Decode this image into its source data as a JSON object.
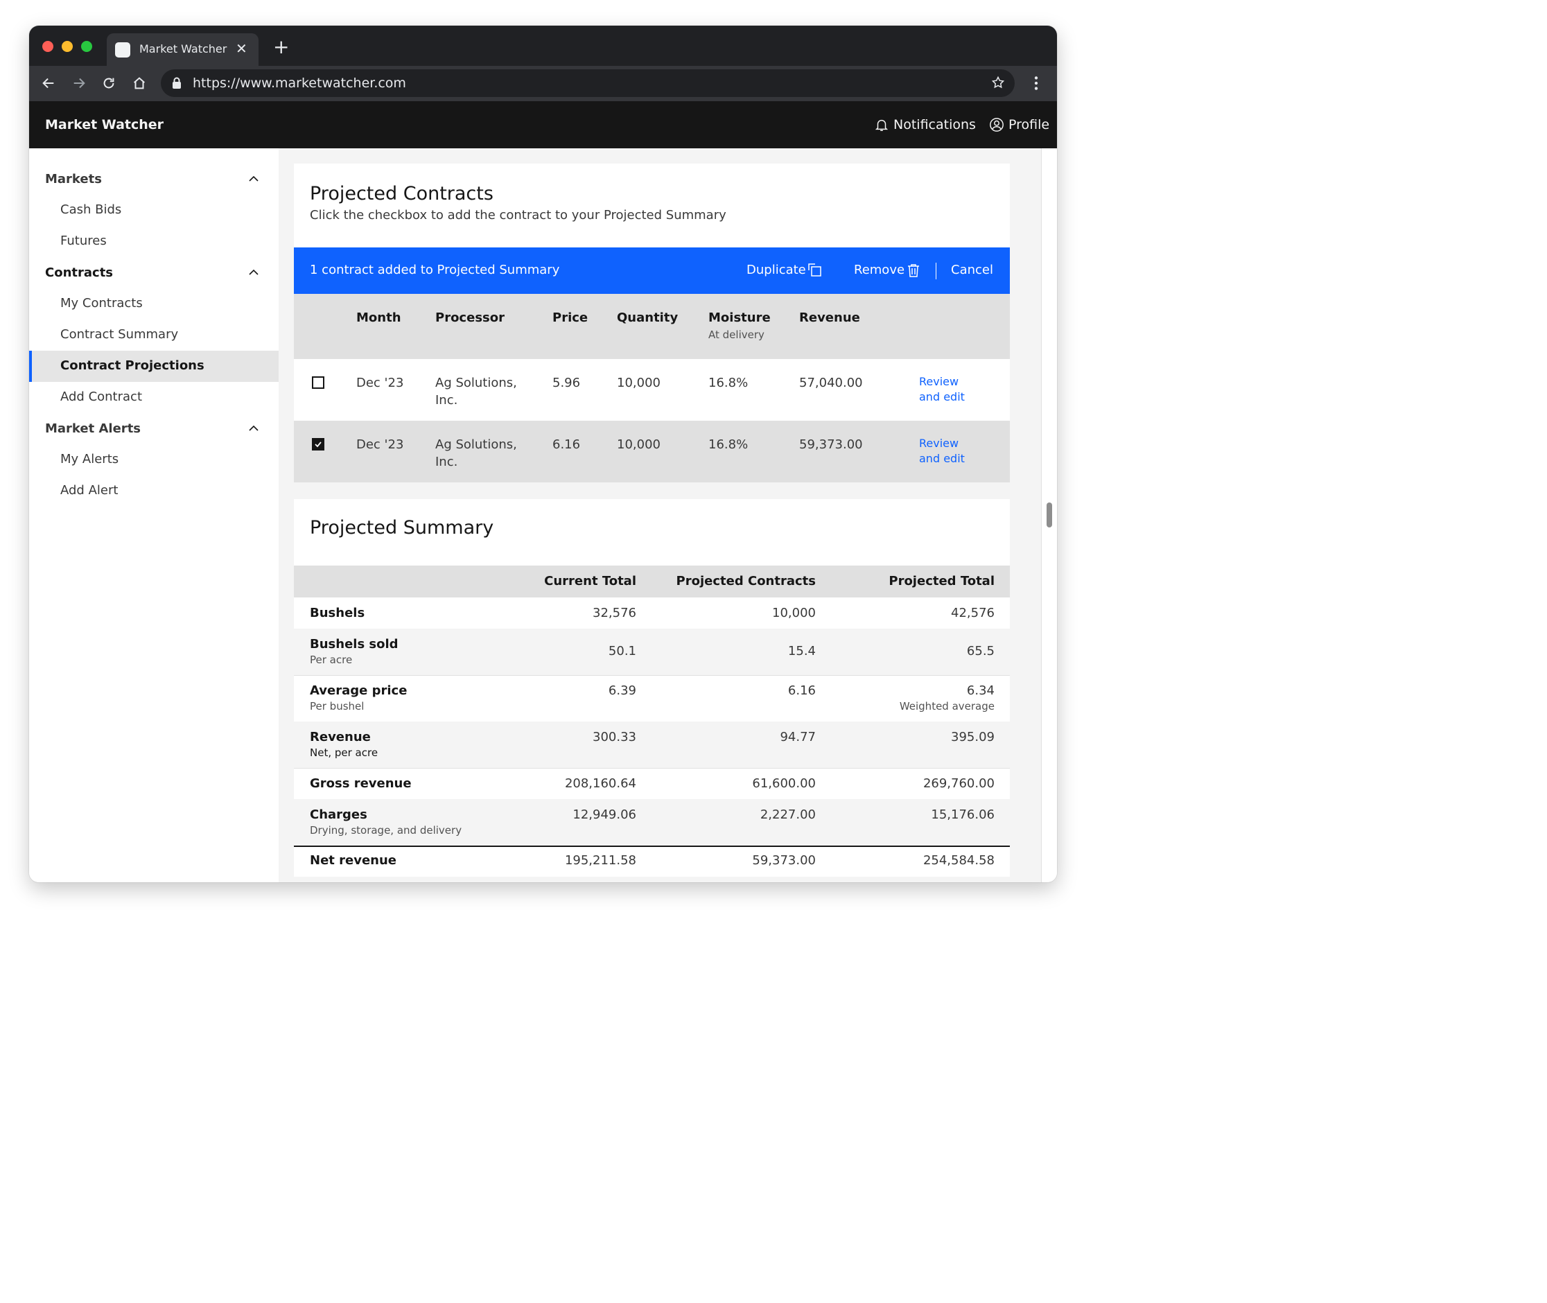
{
  "browser": {
    "tab_title": "Market Watcher",
    "url": "https://www.marketwatcher.com"
  },
  "app": {
    "title": "Market Watcher",
    "notifications_label": "Notifications",
    "profile_label": "Profile"
  },
  "sidebar": {
    "groups": [
      {
        "label": "Markets",
        "items": [
          "Cash Bids",
          "Futures"
        ]
      },
      {
        "label": "Contracts",
        "items": [
          "My Contracts",
          "Contract Summary",
          "Contract Projections",
          "Add Contract"
        ]
      },
      {
        "label": "Market Alerts",
        "items": [
          "My Alerts",
          "Add Alert"
        ]
      }
    ],
    "active_item": "Contract Projections"
  },
  "projected_contracts": {
    "title": "Projected Contracts",
    "subtitle": "Click the checkbox to add the contract to your Projected Summary",
    "action_bar": {
      "message": "1 contract added to Projected Summary",
      "duplicate_label": "Duplicate",
      "remove_label": "Remove",
      "cancel_label": "Cancel"
    },
    "columns": {
      "month": "Month",
      "processor": "Processor",
      "price": "Price",
      "quantity": "Quantity",
      "moisture": "Moisture",
      "moisture_sub": "At delivery",
      "revenue": "Revenue"
    },
    "rows": [
      {
        "checked": false,
        "month": "Dec '23",
        "processor_1": "Ag Solutions,",
        "processor_2": "Inc.",
        "price": "5.96",
        "quantity": "10,000",
        "moisture": "16.8%",
        "revenue": "57,040.00",
        "link_1": "Review",
        "link_2": "and edit"
      },
      {
        "checked": true,
        "month": "Dec '23",
        "processor_1": "Ag Solutions,",
        "processor_2": "Inc.",
        "price": "6.16",
        "quantity": "10,000",
        "moisture": "16.8%",
        "revenue": "59,373.00",
        "link_1": "Review",
        "link_2": "and edit"
      }
    ]
  },
  "projected_summary": {
    "title": "Projected Summary",
    "columns": {
      "current_total": "Current Total",
      "projected_contracts": "Projected Contracts",
      "projected_total": "Projected Total"
    },
    "rows": [
      {
        "label": "Bushels",
        "sub": "",
        "current": "32,576",
        "projected": "10,000",
        "total": "42,576",
        "note": ""
      },
      {
        "label": "Bushels sold",
        "sub": "Per acre",
        "current": "50.1",
        "projected": "15.4",
        "total": "65.5",
        "note": ""
      },
      {
        "label": "Average price",
        "sub": "Per bushel",
        "current": "6.39",
        "projected": "6.16",
        "total": "6.34",
        "note": "Weighted average"
      },
      {
        "label": "Revenue",
        "sub": "Net, per acre",
        "current": "300.33",
        "projected": "94.77",
        "total": "395.09",
        "note": ""
      },
      {
        "label": "Gross revenue",
        "sub": "",
        "current": "208,160.64",
        "projected": "61,600.00",
        "total": "269,760.00",
        "note": ""
      },
      {
        "label": "Charges",
        "sub": "Drying, storage, and delivery",
        "current": "12,949.06",
        "projected": "2,227.00",
        "total": "15,176.06",
        "note": ""
      },
      {
        "label": "Net revenue",
        "sub": "",
        "current": "195,211.58",
        "projected": "59,373.00",
        "total": "254,584.58",
        "note": ""
      }
    ]
  },
  "colors": {
    "accent": "#0f62fe",
    "header_bg": "#161616",
    "browser_chrome": "#202124"
  },
  "icons": [
    "back-arrow-icon",
    "forward-arrow-icon",
    "reload-icon",
    "home-icon",
    "lock-icon",
    "star-icon",
    "kebab-menu-icon",
    "bell-icon",
    "user-avatar-icon",
    "chevron-up-icon",
    "copy-icon",
    "trash-icon",
    "checkmark-icon",
    "close-icon",
    "plus-icon"
  ]
}
